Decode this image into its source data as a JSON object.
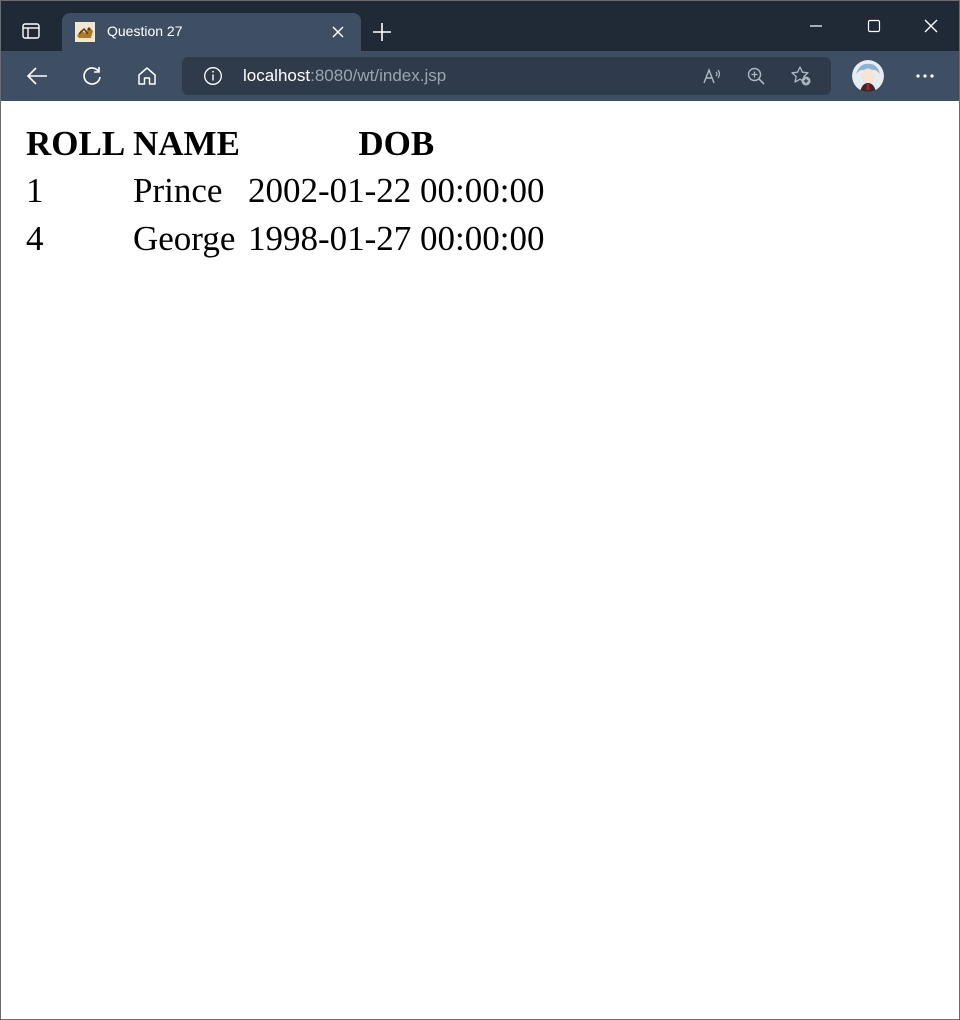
{
  "browser": {
    "tab_title": "Question 27",
    "url_host": "localhost",
    "url_rest": ":8080/wt/index.jsp",
    "icons": {
      "tab_actions": "tab-actions-icon",
      "favicon": "tomcat-favicon-icon",
      "close": "close-icon",
      "new_tab": "plus-icon",
      "minimize": "minimize-icon",
      "maximize": "maximize-icon",
      "window_close": "close-icon",
      "back": "back-arrow-icon",
      "refresh": "refresh-icon",
      "home": "home-icon",
      "info": "info-icon",
      "read_aloud": "read-aloud-icon",
      "zoom": "zoom-in-icon",
      "favorites": "add-favorite-icon",
      "avatar": "profile-avatar",
      "more": "more-options-icon"
    },
    "colors": {
      "tabstrip": "#202a36",
      "toolbar": "#3f4f63",
      "address_bar": "#2f3b4b",
      "url_dim": "#9aa5b1"
    }
  },
  "page": {
    "table": {
      "headers": [
        "ROLL",
        "NAME",
        "DOB"
      ],
      "rows": [
        [
          "1",
          "Prince",
          "2002-01-22 00:00:00"
        ],
        [
          "4",
          "George",
          "1998-01-27 00:00:00"
        ]
      ]
    }
  }
}
